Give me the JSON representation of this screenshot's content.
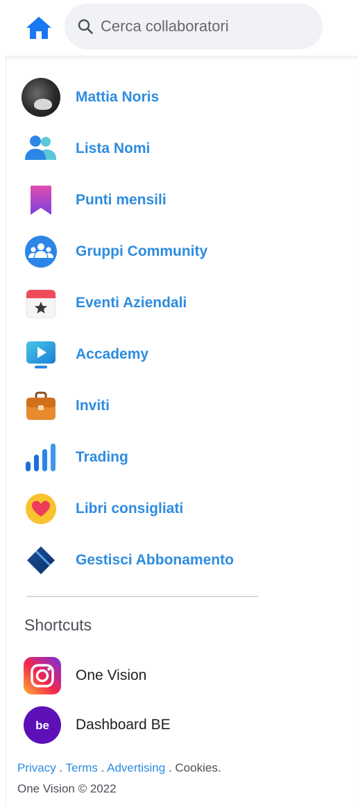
{
  "search": {
    "placeholder": "Cerca collaboratori"
  },
  "menu": [
    {
      "label": "Mattia Noris",
      "icon": "user-avatar"
    },
    {
      "label": "Lista Nomi",
      "icon": "people-icon"
    },
    {
      "label": "Punti mensili",
      "icon": "bookmark-icon"
    },
    {
      "label": "Gruppi Community",
      "icon": "groups-icon"
    },
    {
      "label": "Eventi Aziendali",
      "icon": "calendar-star-icon"
    },
    {
      "label": "Accademy",
      "icon": "play-screen-icon"
    },
    {
      "label": "Inviti",
      "icon": "briefcase-icon"
    },
    {
      "label": "Trading",
      "icon": "bar-chart-icon"
    },
    {
      "label": "Libri consigliati",
      "icon": "heart-icon"
    },
    {
      "label": "Gestisci Abbonamento",
      "icon": "card-icon"
    }
  ],
  "shortcuts": {
    "title": "Shortcuts",
    "items": [
      {
        "label": "One Vision",
        "icon": "instagram-icon"
      },
      {
        "label": "Dashboard BE",
        "icon": "be-logo-icon",
        "logo_text": "be"
      }
    ]
  },
  "footer": {
    "privacy": "Privacy",
    "terms": "Terms",
    "advertising": "Advertising",
    "cookies": "Cookies.",
    "sep": " . ",
    "copyright": "One Vision © 2022"
  },
  "colors": {
    "accent": "#2d8ce0",
    "home": "#1877f2"
  }
}
